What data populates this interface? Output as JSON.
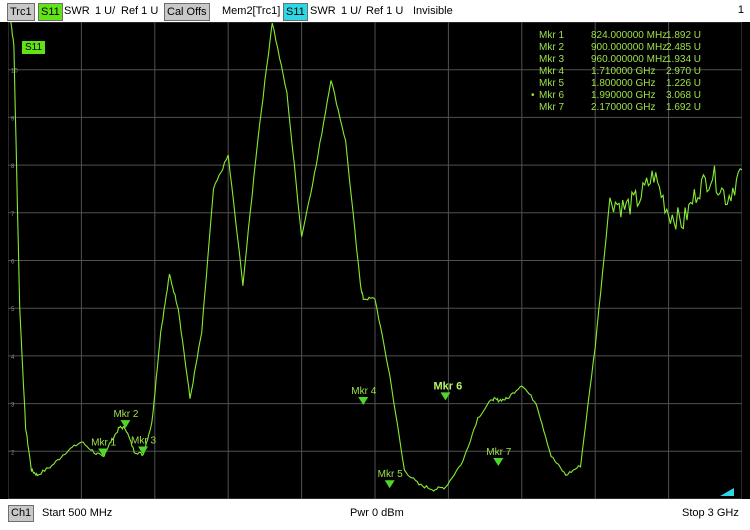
{
  "header": {
    "trace_label": "Trc1",
    "param": "S11",
    "format": "SWR",
    "scale": "1 U/",
    "ref": "Ref 1 U",
    "cal": "Cal Offs",
    "mem_label": "Mem2[Trc1]",
    "mem_param": "S11",
    "mem_format": "SWR",
    "mem_scale": "1 U/",
    "mem_ref": "Ref 1 U",
    "mem_state": "Invisible",
    "channel_index": "1"
  },
  "plot": {
    "trace_tag": "S11",
    "colors": {
      "trace": "#86ec33",
      "grid": "#505050",
      "marker": "#4fd62a",
      "label": "#9ee24a",
      "background": "#000000"
    },
    "y_ticks": [
      "10",
      "9",
      "8",
      "7",
      "6",
      "5",
      "4",
      "3",
      "2"
    ]
  },
  "markers": [
    {
      "name": "Mkr 1",
      "freq": "824.000000 MHz",
      "value": "1.892 U",
      "active": false
    },
    {
      "name": "Mkr 2",
      "freq": "900.000000 MHz",
      "value": "2.485 U",
      "active": false
    },
    {
      "name": "Mkr 3",
      "freq": "960.000000 MHz",
      "value": "1.934 U",
      "active": false
    },
    {
      "name": "Mkr 4",
      "freq": "1.710000 GHz",
      "value": "2.970 U",
      "active": false
    },
    {
      "name": "Mkr 5",
      "freq": "1.800000 GHz",
      "value": "1.226 U",
      "active": false
    },
    {
      "name": "Mkr 6",
      "freq": "1.990000 GHz",
      "value": "3.068 U",
      "active": true
    },
    {
      "name": "Mkr 7",
      "freq": "2.170000 GHz",
      "value": "1.692 U",
      "active": false
    }
  ],
  "footer": {
    "channel": "Ch1",
    "start": "Start  500 MHz",
    "power": "Pwr  0 dBm",
    "stop": "Stop  3 GHz"
  },
  "chart_data": {
    "type": "line",
    "xlabel": "",
    "ylabel": "",
    "x_unit": "MHz",
    "xlim": [
      500,
      3000
    ],
    "ylim": [
      1,
      11
    ],
    "grid": true,
    "series": [
      {
        "name": "S11",
        "x": [
          500,
          520,
          540,
          560,
          580,
          600,
          650,
          700,
          750,
          800,
          824,
          850,
          880,
          900,
          930,
          960,
          990,
          1020,
          1050,
          1080,
          1120,
          1160,
          1200,
          1250,
          1300,
          1350,
          1400,
          1450,
          1500,
          1550,
          1600,
          1650,
          1700,
          1710,
          1750,
          1800,
          1850,
          1900,
          1950,
          1990,
          2050,
          2100,
          2150,
          2170,
          2200,
          2250,
          2300,
          2350,
          2400,
          2450,
          2500,
          2550,
          2600,
          2650,
          2700,
          2750,
          2800,
          2850,
          2900,
          2950,
          3000
        ],
        "y": [
          11.5,
          10.5,
          5.0,
          2.5,
          1.6,
          1.5,
          1.7,
          2.0,
          2.2,
          1.95,
          1.89,
          2.2,
          2.5,
          2.49,
          2.0,
          1.93,
          2.6,
          4.5,
          5.7,
          5.0,
          3.1,
          4.5,
          7.5,
          8.2,
          5.5,
          8.5,
          11.0,
          9.5,
          6.5,
          8.0,
          9.8,
          8.5,
          5.5,
          5.2,
          5.2,
          3.6,
          1.6,
          1.3,
          1.2,
          1.25,
          1.8,
          2.7,
          3.1,
          3.07,
          3.1,
          3.4,
          3.0,
          1.9,
          1.5,
          1.7,
          4.2,
          7.3,
          7.1,
          7.3,
          7.8,
          7.0,
          6.8,
          7.5,
          7.8,
          7.3,
          7.9
        ]
      }
    ],
    "markers": [
      {
        "name": "Mkr 1",
        "x": 824,
        "y": 1.892
      },
      {
        "name": "Mkr 2",
        "x": 900,
        "y": 2.485
      },
      {
        "name": "Mkr 3",
        "x": 960,
        "y": 1.934
      },
      {
        "name": "Mkr 4",
        "x": 1710,
        "y": 2.97
      },
      {
        "name": "Mkr 5",
        "x": 1800,
        "y": 1.226
      },
      {
        "name": "Mkr 6",
        "x": 1990,
        "y": 3.068
      },
      {
        "name": "Mkr 7",
        "x": 2170,
        "y": 1.692
      }
    ]
  }
}
